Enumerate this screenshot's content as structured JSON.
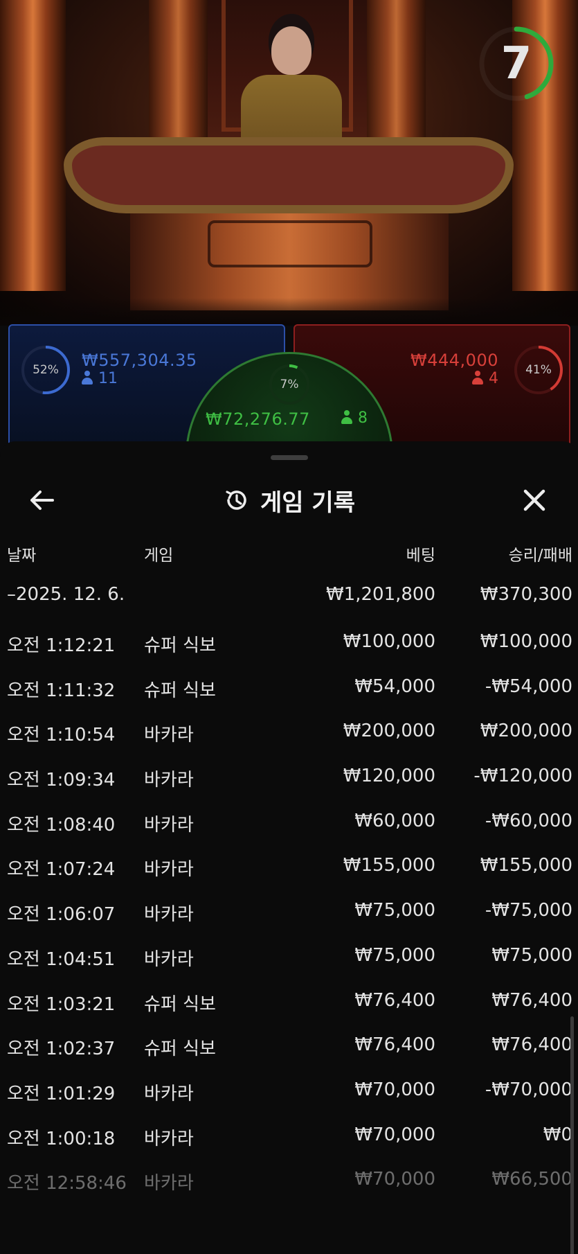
{
  "stage": {
    "timer_value": "7",
    "timer_fraction": 0.45
  },
  "bets": {
    "player": {
      "percent_label": "52%",
      "percent": 52,
      "amount": "₩557,304.35",
      "players": "11",
      "color": "#4a78d8"
    },
    "tie": {
      "percent_label": "7%",
      "percent": 7,
      "amount": "₩72,276.77",
      "players": "8",
      "color": "#3fbf44"
    },
    "banker": {
      "amount": "₩444,000",
      "players": "4",
      "percent_label": "41%",
      "percent": 41,
      "color": "#d8403a"
    }
  },
  "sheet": {
    "title": "게임 기록",
    "icons": {
      "back": "arrow-left-icon",
      "history": "history-icon",
      "close": "close-icon"
    },
    "columns": {
      "date": "날짜",
      "game": "게임",
      "bet": "베팅",
      "winloss": "승리/패배"
    },
    "summary": {
      "date": "–2025. 12. 6.",
      "bet": "₩1,201,800",
      "winloss": "₩370,300"
    },
    "rows": [
      {
        "time": "오전 1:12:21",
        "game": "슈퍼 식보",
        "bet": "₩100,000",
        "winloss": "₩100,000"
      },
      {
        "time": "오전 1:11:32",
        "game": "슈퍼 식보",
        "bet": "₩54,000",
        "winloss": "-₩54,000"
      },
      {
        "time": "오전 1:10:54",
        "game": "바카라",
        "bet": "₩200,000",
        "winloss": "₩200,000"
      },
      {
        "time": "오전 1:09:34",
        "game": "바카라",
        "bet": "₩120,000",
        "winloss": "-₩120,000"
      },
      {
        "time": "오전 1:08:40",
        "game": "바카라",
        "bet": "₩60,000",
        "winloss": "-₩60,000"
      },
      {
        "time": "오전 1:07:24",
        "game": "바카라",
        "bet": "₩155,000",
        "winloss": "₩155,000"
      },
      {
        "time": "오전 1:06:07",
        "game": "바카라",
        "bet": "₩75,000",
        "winloss": "-₩75,000"
      },
      {
        "time": "오전 1:04:51",
        "game": "바카라",
        "bet": "₩75,000",
        "winloss": "₩75,000"
      },
      {
        "time": "오전 1:03:21",
        "game": "슈퍼 식보",
        "bet": "₩76,400",
        "winloss": "₩76,400"
      },
      {
        "time": "오전 1:02:37",
        "game": "슈퍼 식보",
        "bet": "₩76,400",
        "winloss": "₩76,400"
      },
      {
        "time": "오전 1:01:29",
        "game": "바카라",
        "bet": "₩70,000",
        "winloss": "-₩70,000"
      },
      {
        "time": "오전 1:00:18",
        "game": "바카라",
        "bet": "₩70,000",
        "winloss": "₩0"
      },
      {
        "time": "오전 12:58:46",
        "game": "바카라",
        "bet": "₩70,000",
        "winloss": "₩66,500"
      }
    ]
  }
}
